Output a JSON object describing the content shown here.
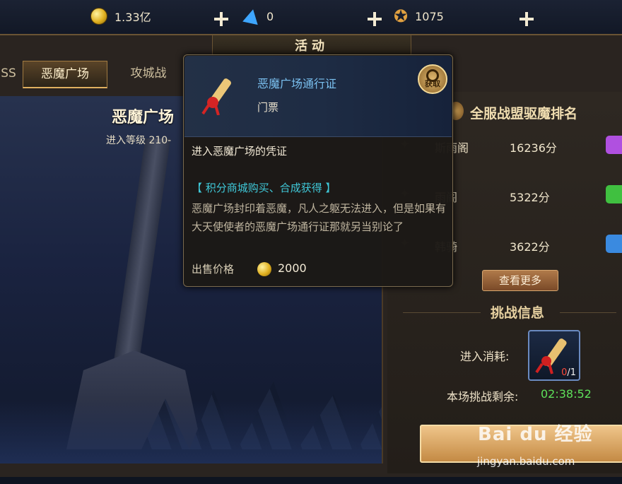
{
  "currency": [
    {
      "icon": "gold-coin-icon",
      "value": "1.33亿"
    },
    {
      "icon": "blue-diamond-icon",
      "value": "0"
    },
    {
      "icon": "star-badge-icon",
      "value": "1075"
    }
  ],
  "window_title": "活动",
  "tabs": [
    {
      "label": "SS"
    },
    {
      "label": "恶魔广场",
      "active": true
    },
    {
      "label": "攻城战"
    }
  ],
  "scene": {
    "title": "恶魔广场",
    "level_text": "进入等级 210-"
  },
  "ranking": {
    "title": "全服战盟驱魔排名",
    "rows": [
      {
        "name": "斯雨阁",
        "score": "16236分",
        "chest_color": "#b050e0"
      },
      {
        "name": "雨阁",
        "score": "5322分",
        "chest_color": "#40c040"
      },
      {
        "name": "韩骑",
        "score": "3622分",
        "chest_color": "#3a8ae0"
      }
    ],
    "more_label": "查看更多"
  },
  "challenge": {
    "title": "挑战信息",
    "cost_label": "进入消耗:",
    "cost_have": "0",
    "cost_need": "/1",
    "remain_label": "本场挑战剩余:",
    "remain_value": "02:38:52"
  },
  "watermark": {
    "line1": "Bai du 经验",
    "line2": "jingyan.baidu.com"
  },
  "tooltip": {
    "item_name": "恶魔广场通行证",
    "item_type": "门票",
    "get_label": "获取",
    "desc": "进入恶魔广场的凭证",
    "source": "【 积分商城购买、合成获得 】",
    "lore": "恶魔广场封印着恶魔，凡人之躯无法进入，但是如果有大天使使者的恶魔广场通行证那就另当别论了",
    "price_label": "出售价格",
    "price_value": "2000"
  },
  "colors": {
    "accent_gold": "#e0b060",
    "item_name_blue": "#7ac0f0",
    "source_cyan": "#3fc8d8",
    "timer_green": "#5ee05a",
    "cost_red": "#ff4a3a"
  }
}
